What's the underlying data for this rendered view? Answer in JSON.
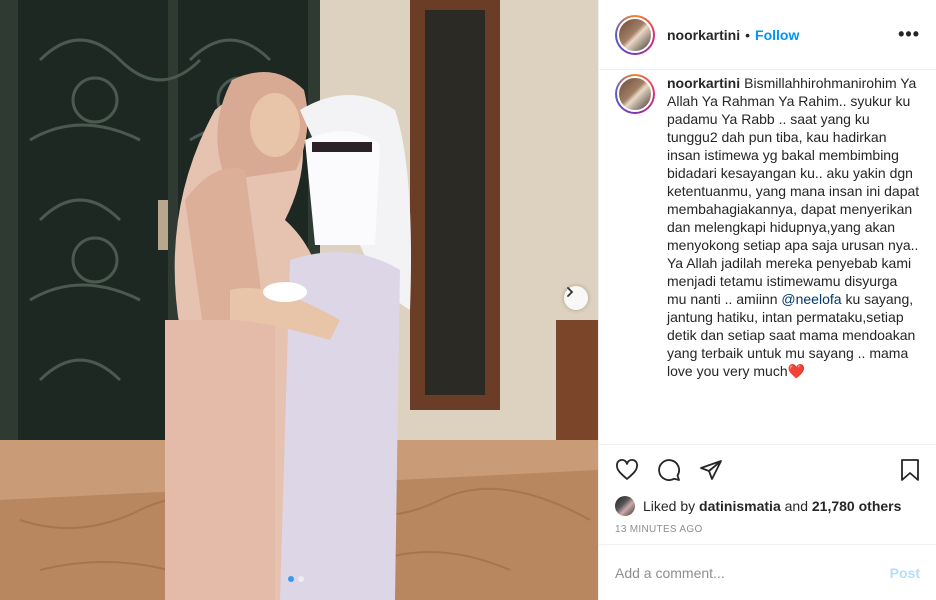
{
  "header": {
    "username": "noorkartini",
    "separator": "•",
    "follow_label": "Follow",
    "more_label": "•••"
  },
  "caption": {
    "username": "noorkartini",
    "text_before_mention": "Bismillahhirohmanirohim Ya Allah Ya Rahman Ya Rahim.. syukur ku padamu Ya Rabb .. saat yang ku tunggu2 dah pun tiba, kau hadirkan insan istimewa yg bakal membimbing bidadari kesayangan ku.. aku yakin dgn ketentuanmu, yang mana insan ini dapat membahagiakannya, dapat menyerikan dan melengkapi hidupnya,yang akan menyokong setiap apa saja urusan nya.. Ya Allah jadilah mereka penyebab kami menjadi tetamu istimewamu disyurga mu nanti .. amiinn",
    "mention": "@neelofa",
    "text_after_mention": "ku sayang, jantung hatiku, intan permataku,setiap detik dan setiap saat mama mendoakan yang terbaik untuk mu sayang .. mama love you very much",
    "emoji": "❤️"
  },
  "actions": {
    "like_icon": "heart-outline-icon",
    "comment_icon": "comment-bubble-icon",
    "share_icon": "paper-plane-icon",
    "save_icon": "bookmark-icon"
  },
  "likes": {
    "prefix": "Liked by",
    "user": "datinismatia",
    "middle": "and",
    "count": "21,780 others"
  },
  "timestamp": "13 MINUTES AGO",
  "comment_box": {
    "placeholder": "Add a comment...",
    "post_label": "Post"
  },
  "carousel": {
    "next_icon": "chevron-right-icon",
    "dots": 2,
    "active_dot": 0
  },
  "colors": {
    "accent": "#0095f6",
    "mention": "#00376b",
    "post_disabled": "#b2dffc",
    "muted": "#8e8e8e"
  }
}
